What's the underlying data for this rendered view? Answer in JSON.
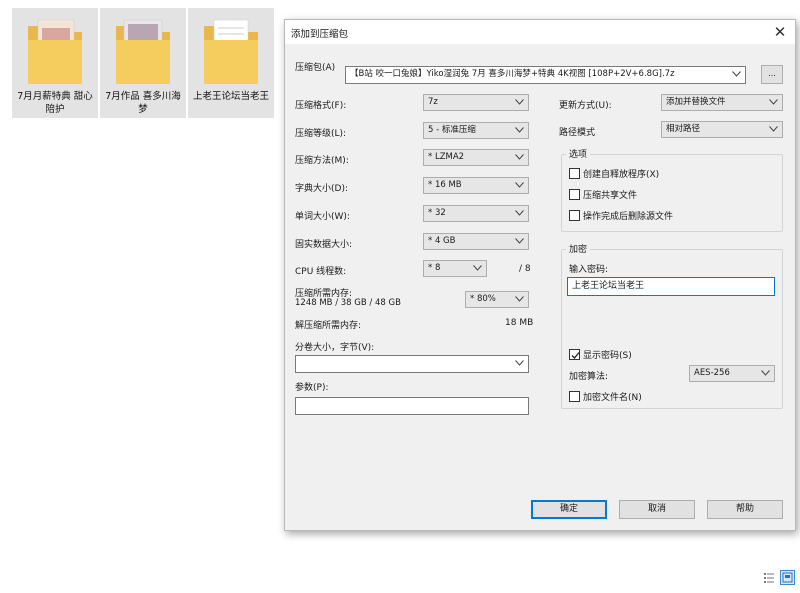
{
  "explorer": {
    "folders": [
      {
        "label": "7月月薪特典 甜心陪护"
      },
      {
        "label": "7月作品 喜多川海梦"
      },
      {
        "label": "上老王论坛当老王"
      }
    ]
  },
  "dialog": {
    "title": "添加到压缩包",
    "archive_label": "压缩包(A)",
    "archive_value": "【B站 咬一口兔娘】Yiko湿润兔 7月 喜多川海梦+特典 4K视图 [108P+2V+6.8G].7z",
    "browse_label": "...",
    "format_label": "压缩格式(F):",
    "format_value": "7z",
    "level_label": "压缩等级(L):",
    "level_value": "5 - 标准压缩",
    "method_label": "压缩方法(M):",
    "method_value": "* LZMA2",
    "dict_label": "字典大小(D):",
    "dict_value": "* 16 MB",
    "word_label": "单词大小(W):",
    "word_value": "* 32",
    "solid_label": "固实数据大小:",
    "solid_value": "* 4 GB",
    "threads_label": "CPU 线程数:",
    "threads_value": "* 8",
    "threads_total": "/ 8",
    "mem_comp_label": "压缩所需内存:",
    "mem_comp_detail": "1248 MB / 38 GB / 48 GB",
    "mem_comp_value": "* 80%",
    "mem_decomp_label": "解压缩所需内存:",
    "mem_decomp_value": "18 MB",
    "split_label": "分卷大小，字节(V):",
    "split_value": "",
    "params_label": "参数(P):",
    "params_value": "",
    "update_label": "更新方式(U):",
    "update_value": "添加并替换文件",
    "path_label": "路径模式",
    "path_value": "相对路径",
    "options_title": "选项",
    "opt_sfx": "创建自释放程序(X)",
    "opt_shared": "压缩共享文件",
    "opt_delete": "操作完成后删除源文件",
    "encrypt_title": "加密",
    "password_label": "输入密码:",
    "password_value": "上老王论坛当老王",
    "show_password": "显示密码(S)",
    "algo_label": "加密算法:",
    "algo_value": "AES-256",
    "encrypt_names": "加密文件名(N)",
    "ok_label": "确定",
    "cancel_label": "取消",
    "help_label": "帮助",
    "close_label": "✕"
  }
}
